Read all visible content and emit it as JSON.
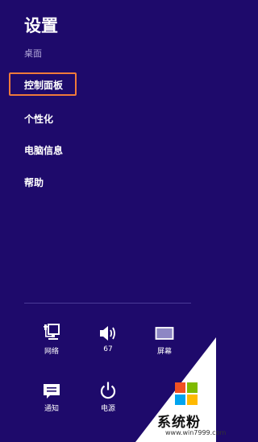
{
  "panel": {
    "title": "设置",
    "subtitle": "桌面",
    "items": [
      {
        "label": "控制面板"
      },
      {
        "label": "个性化"
      },
      {
        "label": "电脑信息"
      },
      {
        "label": "帮助"
      }
    ]
  },
  "tiles": [
    {
      "label": "网络",
      "icon": "network-icon"
    },
    {
      "label": "67",
      "icon": "volume-icon"
    },
    {
      "label": "屏幕",
      "icon": "screen-icon"
    },
    {
      "label": "通知",
      "icon": "notifications-icon"
    },
    {
      "label": "电源",
      "icon": "power-icon"
    }
  ],
  "watermark": {
    "brand": "系统粉",
    "site": "www.win7999.com",
    "icon": "windows-logo-icon"
  },
  "colors": {
    "background": "#1e0a6b",
    "highlight": "#f07a3a"
  }
}
